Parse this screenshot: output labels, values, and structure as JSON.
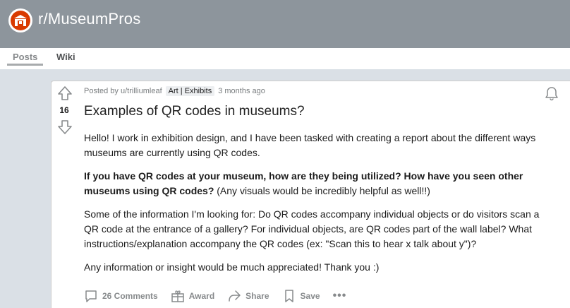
{
  "subreddit": {
    "name": "r/MuseumPros",
    "icon": "museum-building-icon",
    "banner_color": "#8d959c"
  },
  "nav": {
    "tabs": [
      {
        "label": "Posts",
        "active": true
      },
      {
        "label": "Wiki",
        "active": false
      }
    ]
  },
  "post": {
    "score": "16",
    "meta": {
      "prefix": "Posted by",
      "author": "u/trilliumleaf",
      "flair": "Art | Exhibits",
      "time": "3 months ago"
    },
    "title": "Examples of QR codes in museums?",
    "body": {
      "p1": "Hello! I work in exhibition design, and I have been tasked with creating a report about the different ways museums are currently using QR codes.",
      "p2_bold": "If you have QR codes at your museum, how are they being utilized? How have you seen other museums using QR codes?",
      "p2_rest": " (Any visuals would be incredibly helpful as well!!)",
      "p3": "Some of the information I'm looking for: Do QR codes accompany individual objects or do visitors scan a QR code at the entrance of a gallery? For individual objects, are QR codes part of the wall label? What instructions/explanation accompany the QR codes (ex: \"Scan this to hear x talk about y\")?",
      "p4": "Any information or insight would be much appreciated! Thank you :)"
    },
    "actions": {
      "comments": "26 Comments",
      "award": "Award",
      "share": "Share",
      "save": "Save",
      "more": "•••"
    }
  },
  "colors": {
    "page_bg": "#dae0e6",
    "accent": "#d93a00",
    "muted": "#878a8c"
  }
}
